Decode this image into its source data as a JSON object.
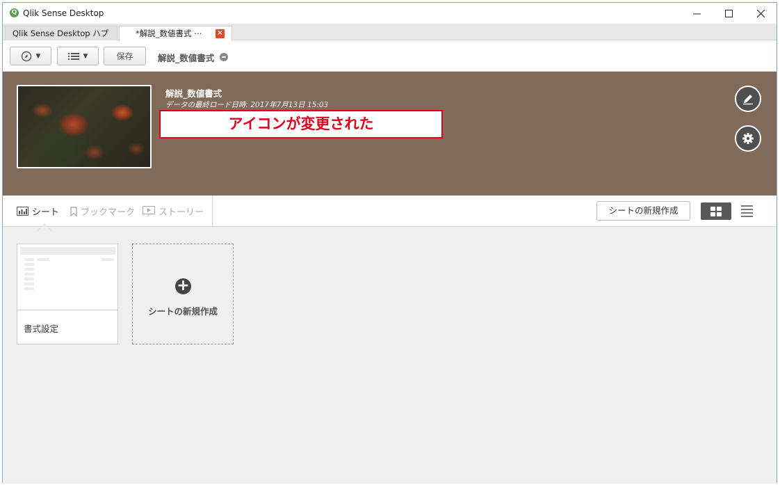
{
  "window": {
    "title": "Qlik Sense Desktop",
    "app_icon_glyph": "Q"
  },
  "tabs": [
    {
      "label": "Qlik Sense Desktop ハブ"
    },
    {
      "label": "*解説_数値書式 ⋯"
    }
  ],
  "toolbar": {
    "save_label": "保存",
    "app_name": "解説_数値書式"
  },
  "banner": {
    "title": "解説_数値書式",
    "subtitle": "データの最終ロード日時: 2017年7月13日 15:03",
    "callout": "アイコンが変更された",
    "bg_color": "#806a59"
  },
  "nav": {
    "sheets_label": "シート",
    "bookmarks_label": "ブックマーク",
    "stories_label": "ストーリー",
    "new_sheet_label": "シートの新規作成"
  },
  "sheets": [
    {
      "title": "書式設定"
    }
  ],
  "new_sheet_card": {
    "label": "シートの新規作成"
  },
  "colors": {
    "accent_red": "#e0001b",
    "dark_button": "#4f4f4f"
  }
}
